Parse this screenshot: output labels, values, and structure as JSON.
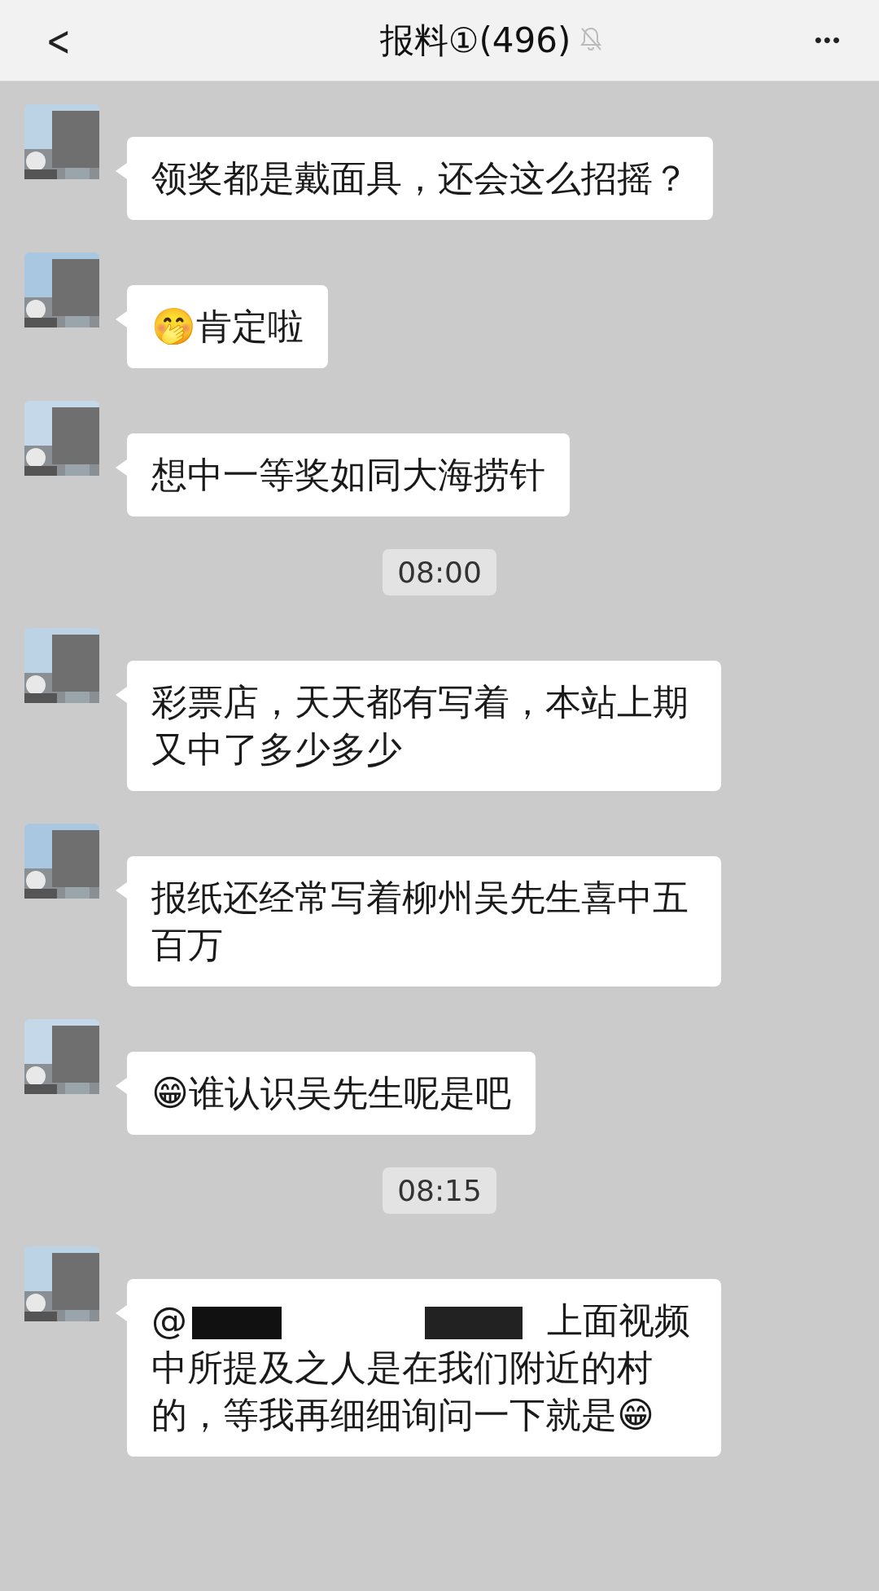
{
  "header": {
    "back": "<",
    "title": "报料①(496)",
    "muted": true,
    "more": "•••"
  },
  "messages": [
    {
      "kind": "text",
      "text": "领奖都是戴面具，还会这么招摇？"
    },
    {
      "kind": "text",
      "text": "🤭肯定啦"
    },
    {
      "kind": "text",
      "text": "想中一等奖如同大海捞针"
    },
    {
      "kind": "time",
      "text": "08:00"
    },
    {
      "kind": "text",
      "text": "彩票店，天天都有写着，本站上期又中了多少多少"
    },
    {
      "kind": "text",
      "text": "报纸还经常写着柳州吴先生喜中五百万"
    },
    {
      "kind": "text",
      "text": "😁谁认识吴先生呢是吧"
    },
    {
      "kind": "time",
      "text": "08:15"
    },
    {
      "kind": "mention",
      "mention": "@",
      "text": "上面视频中所提及之人是在我们附近的村的，等我再细细询问一下就是😁"
    }
  ]
}
